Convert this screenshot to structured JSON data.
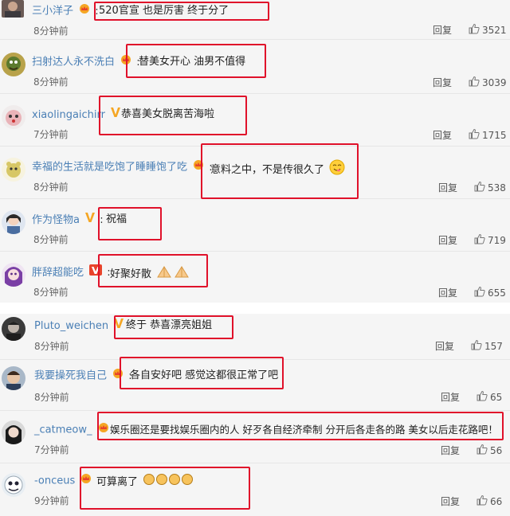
{
  "reply_label": "回复",
  "comments_upper": [
    {
      "user": "三小洋子",
      "badge": "crown",
      "text": "520官宣 也是厉害 终于分了",
      "time": "8分钟前",
      "likes": "3521"
    },
    {
      "user": "扫射达人永不洗白",
      "badge": "crown",
      "text": "替美女开心 油男不值得",
      "time": "8分钟前",
      "likes": "3039"
    },
    {
      "user": "xiaolingaichirr",
      "badge": "v-gold",
      "text": "恭喜美女脱离苦海啦",
      "time": "7分钟前",
      "likes": "1715"
    },
    {
      "user": "幸福的生活就是吃饱了睡睡饱了吃",
      "badge": "crown",
      "text": "意料之中，不是传很久了",
      "time": "8分钟前",
      "likes": "538"
    },
    {
      "user": "作为怪物a",
      "badge": "v-gold",
      "text": "祝福",
      "time": "8分钟前",
      "likes": "719"
    },
    {
      "user": "胖辞超能吃",
      "badge": "v-red",
      "text": "好聚好散",
      "time": "8分钟前",
      "likes": "655"
    }
  ],
  "comments_lower": [
    {
      "user": "Pluto_weichen",
      "badge": "v-gold",
      "text": "终于 恭喜漂亮姐姐",
      "time": "8分钟前",
      "likes": "157"
    },
    {
      "user": "我要操死我自己",
      "badge": "crown",
      "text": "各自安好吧 感觉这都很正常了吧",
      "time": "8分钟前",
      "likes": "65"
    },
    {
      "user": "_catmeow_",
      "badge": "crown",
      "text": "娱乐圈还是要找娱乐圈内的人 好歹各自经济牵制 分开后各走各的路 美女以后走花路吧！",
      "time": "7分钟前",
      "likes": "56"
    },
    {
      "user": "-onceus",
      "badge": "crown",
      "text": "可算离了",
      "time": "9分钟前",
      "likes": "66"
    }
  ],
  "colors": {
    "username": "#4a7fb5",
    "highlight_box": "#e0112a",
    "badge_gold": "#f5a623",
    "badge_red": "#e8432b"
  }
}
